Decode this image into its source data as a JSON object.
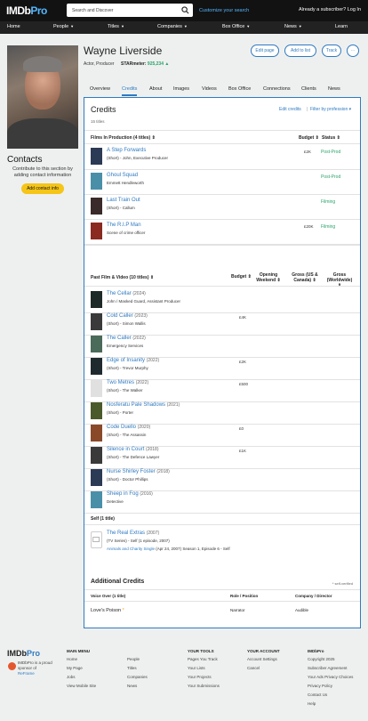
{
  "header": {
    "logo_main": "IMDb",
    "logo_pro": "Pro",
    "search_placeholder": "Search and Discover",
    "customize": "Customize your search",
    "subscriber": "Already a subscriber? Log In"
  },
  "nav": [
    {
      "label": "Home",
      "caret": ""
    },
    {
      "label": "People",
      "caret": "▼"
    },
    {
      "label": "Titles",
      "caret": "▼"
    },
    {
      "label": "Companies",
      "caret": "▼"
    },
    {
      "label": "Box Office",
      "caret": "▼"
    },
    {
      "label": "News",
      "caret": "▼"
    },
    {
      "label": "Learn",
      "caret": ""
    }
  ],
  "profile": {
    "name": "Wayne Liverside",
    "role": "Actor, Producer",
    "starmeter_label": "STARmeter:",
    "starmeter_value": "925,234",
    "starmeter_arrow": "▲",
    "buttons": [
      "Edit page",
      "Add to list",
      "Track",
      "⋯"
    ]
  },
  "contacts": {
    "heading": "Contacts",
    "text": "Contribute to this section by adding contact information",
    "button": "Add contact info"
  },
  "tabs": [
    "Overview",
    "Credits",
    "About",
    "Images",
    "Videos",
    "Box Office",
    "Connections",
    "Clients",
    "News"
  ],
  "credits": {
    "heading": "Credits",
    "titles_count": "15 titles",
    "edit": "Edit credits",
    "separator": "|",
    "filter": "Filter by profession ▾",
    "in_production": {
      "header": "Films In Production (4 titles) ⇕",
      "col_budget": "Budget ⇕",
      "col_status": "Status ⇕",
      "rows": [
        {
          "title": "A Step Forwards",
          "year": "",
          "sub": "(Short) - John, Executive Producer",
          "budget": "£2K",
          "status": "Post-Prod"
        },
        {
          "title": "Ghoul Squad",
          "year": "",
          "sub": "Emmett Hendleworth",
          "budget": "",
          "status": "Post-Prod"
        },
        {
          "title": "Last Train Out",
          "year": "",
          "sub": "(Short) - Callum",
          "budget": "",
          "status": "Filming"
        },
        {
          "title": "The R.I.P Man",
          "year": "",
          "sub": "Scene of crime officer",
          "budget": "£20K",
          "status": "Filming"
        }
      ]
    },
    "past": {
      "header": "Past Film & Video (10 titles) ⇕",
      "col_budget": "Budget ⇕",
      "col_opening": "Opening Weekend ⇕",
      "col_gross_us": "Gross (US & Canada) ⇕",
      "col_gross_world": "Gross (Worldwide) ⇕",
      "rows": [
        {
          "title": "The Cellar",
          "year": "(2024)",
          "sub": "John / Masked Guard, Assistant Producer",
          "budget": ""
        },
        {
          "title": "Cold Caller",
          "year": "(2023)",
          "sub": "(Short) - Simon Wallis",
          "budget": "£4K"
        },
        {
          "title": "The Caller",
          "year": "(2022)",
          "sub": "Emergency Services",
          "budget": ""
        },
        {
          "title": "Edge of Insanity",
          "year": "(2022)",
          "sub": "(Short) - Trevor Murphy",
          "budget": "£2K"
        },
        {
          "title": "Two Metres",
          "year": "(2022)",
          "sub": "(Short) - The Walker",
          "budget": "£500"
        },
        {
          "title": "Nosferatu Pale Shadows",
          "year": "(2021)",
          "sub": "(Short) - Porter",
          "budget": ""
        },
        {
          "title": "Code Duello",
          "year": "(2020)",
          "sub": "(Short) - The Assassin",
          "budget": "£0"
        },
        {
          "title": "Silence in Court",
          "year": "(2018)",
          "sub": "(Short) - The Defence Lawyer",
          "budget": "£1K"
        },
        {
          "title": "Nurse Shirley Foster",
          "year": "(2018)",
          "sub": "(Short) - Doctor Phillips",
          "budget": ""
        },
        {
          "title": "Sheep in Fog",
          "year": "(2016)",
          "sub": "Detective",
          "budget": ""
        }
      ]
    },
    "self": {
      "header": "Self (1 title)",
      "title": "The Real Extras",
      "year": "(2007)",
      "sub": "(TV Series) - Self (1 episode, 2007)",
      "episode": "Animals and Charity Single",
      "episode_rest": "(Apr 24, 2007) Season 1, Episode 6 - Self"
    },
    "additional": {
      "heading": "Additional Credits",
      "self_verified": "* self-verified",
      "col1": "Voice Over (1 title)",
      "col2": "Role / Position",
      "col3": "Company / Director",
      "row_title": "Love's Poison",
      "row_mark": "*",
      "row_role": "Narrator",
      "row_company": "Audible"
    }
  },
  "footer": {
    "logo_main": "IMDb",
    "logo_pro": "Pro",
    "note1": "IMDbPro is a proud",
    "note2": "sponsor of",
    "note3": "ReFrame",
    "main_menu": {
      "heading": "MAIN MENU",
      "col1": [
        "Home",
        "My Page",
        "Jobs",
        "View Mobile Site"
      ],
      "col2": [
        "People",
        "Titles",
        "Companies",
        "News"
      ]
    },
    "tools": {
      "heading": "YOUR TOOLS",
      "links": [
        "Pages You Track",
        "Your Lists",
        "Your Projects",
        "Your Submissions"
      ]
    },
    "account": {
      "heading": "YOUR ACCOUNT",
      "links": [
        "Account Settings",
        "Cancel"
      ]
    },
    "imdbpro": {
      "heading": "IMDbPro",
      "links": [
        "Copyright 2025",
        "Subscriber Agreement",
        "Your Ads Privacy Choices",
        "Privacy Policy",
        "Contact Us",
        "Help"
      ]
    }
  }
}
